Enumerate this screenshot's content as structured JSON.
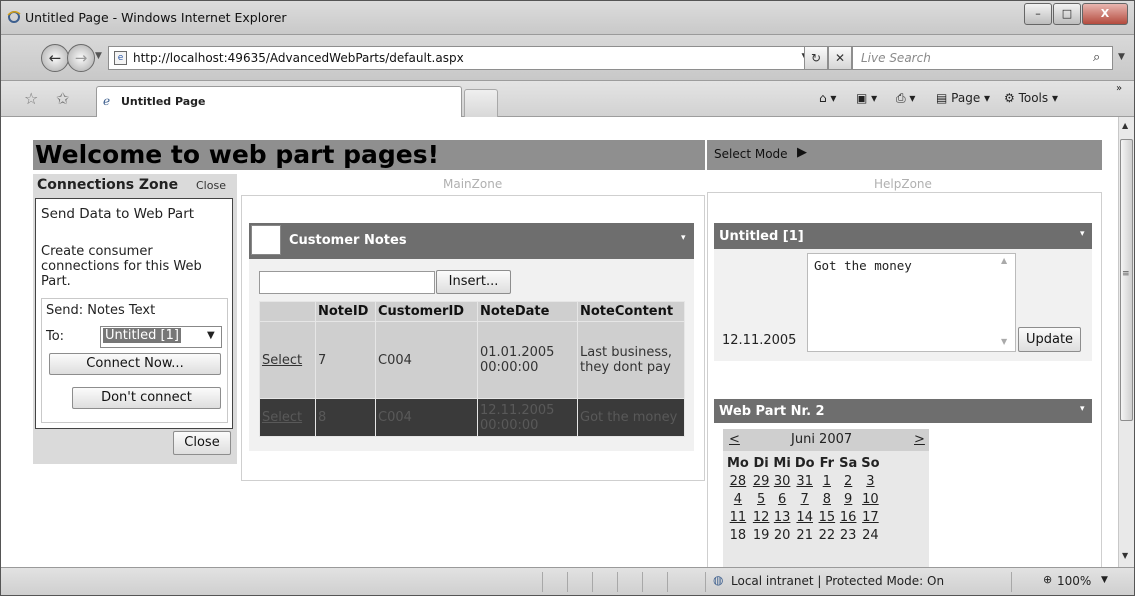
{
  "window": {
    "title": "Untitled Page - Windows Internet Explorer",
    "minimize": "–",
    "maximize": "□",
    "close": "X"
  },
  "address_bar": {
    "url": "http://localhost:49635/AdvancedWebParts/default.aspx",
    "search_placeholder": "Live Search"
  },
  "tab": {
    "label": "Untitled Page"
  },
  "toolbar": {
    "page_label": "Page",
    "tools_label": "Tools"
  },
  "page": {
    "title": "Welcome to web part pages!",
    "select_mode": "Select Mode",
    "main_zone_label": "MainZone",
    "help_zone_label": "HelpZone"
  },
  "connections_zone": {
    "title": "Connections Zone",
    "close_link": "Close",
    "send_data": "Send Data to Web Part",
    "create_text": "Create consumer connections for this Web Part.",
    "send_label": "Send: Notes Text",
    "to_label": "To:",
    "to_selected": "Untitled [1]",
    "connect_now": "Connect Now...",
    "dont_connect": "Don't connect",
    "close_button": "Close"
  },
  "customer_notes": {
    "title": "Customer Notes",
    "insert_label": "Insert...",
    "insert_value": "",
    "columns": [
      "",
      "NoteID",
      "CustomerID",
      "NoteDate",
      "NoteContent"
    ],
    "rows": [
      {
        "action": "Select",
        "note_id": "7",
        "customer_id": "C004",
        "note_date": "01.01.2005 00:00:00",
        "note_content": "Last business, they dont pay"
      },
      {
        "action": "Select",
        "note_id": "8",
        "customer_id": "C004",
        "note_date": "12.11.2005 00:00:00",
        "note_content": "Got the money"
      }
    ]
  },
  "untitled_part": {
    "title": "Untitled [1]",
    "date": "12.11.2005",
    "text_value": "Got the money",
    "update_label": "Update"
  },
  "web_part_2": {
    "title": "Web Part Nr. 2",
    "calendar": {
      "prev": "<",
      "next": ">",
      "month": "Juni 2007",
      "day_headers": [
        "Mo",
        "Di",
        "Mi",
        "Do",
        "Fr",
        "Sa",
        "So"
      ],
      "weeks": [
        [
          "28",
          "29",
          "30",
          "31",
          "1",
          "2",
          "3"
        ],
        [
          "4",
          "5",
          "6",
          "7",
          "8",
          "9",
          "10"
        ],
        [
          "11",
          "12",
          "13",
          "14",
          "15",
          "16",
          "17"
        ],
        [
          "18",
          "19",
          "20",
          "21",
          "22",
          "23",
          "24"
        ]
      ]
    }
  },
  "status_bar": {
    "zone_text": "Local intranet | Protected Mode: On",
    "zoom": "100%"
  }
}
